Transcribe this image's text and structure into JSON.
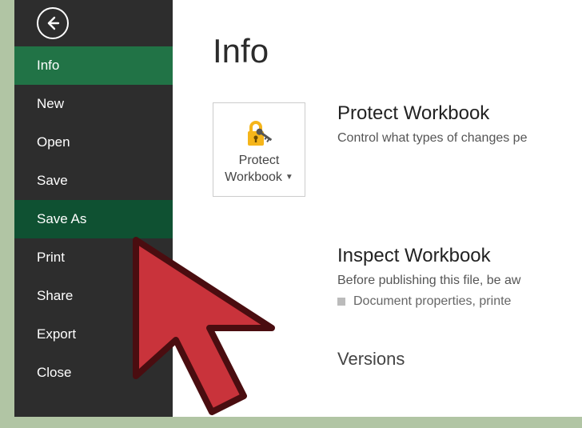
{
  "sidebar": {
    "items": [
      {
        "label": "Info",
        "state": "active"
      },
      {
        "label": "New",
        "state": ""
      },
      {
        "label": "Open",
        "state": ""
      },
      {
        "label": "Save",
        "state": ""
      },
      {
        "label": "Save As",
        "state": "pointed"
      },
      {
        "label": "Print",
        "state": ""
      },
      {
        "label": "Share",
        "state": ""
      },
      {
        "label": "Export",
        "state": ""
      },
      {
        "label": "Close",
        "state": ""
      }
    ]
  },
  "page": {
    "title": "Info"
  },
  "protect": {
    "tile_line1": "Protect",
    "tile_line2": "Workbook",
    "heading": "Protect Workbook",
    "desc": "Control what types of changes pe"
  },
  "inspect": {
    "heading": "Inspect Workbook",
    "desc": "Before publishing this file, be aw",
    "bullet": "Document properties, printe"
  },
  "versions": {
    "heading": "Versions"
  }
}
